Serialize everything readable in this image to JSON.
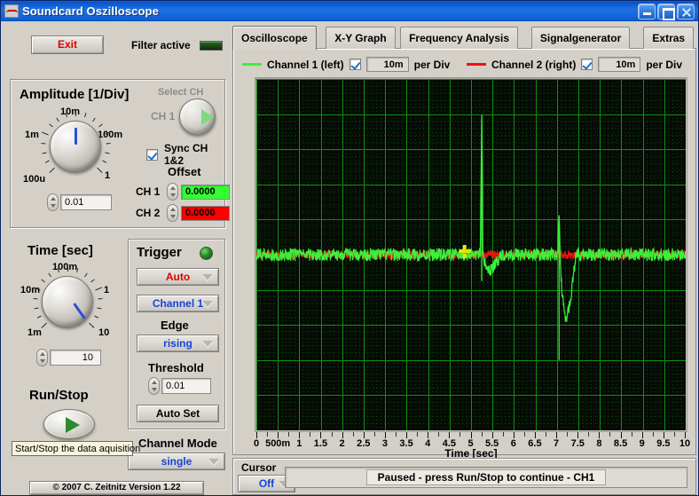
{
  "window": {
    "title": "Soundcard Oszilloscope",
    "icon": "app-waveform-icon",
    "minimize": "minimize-icon",
    "maximize": "maximize-icon",
    "close": "close-icon"
  },
  "left": {
    "exit_label": "Exit",
    "filter_label": "Filter active",
    "amplitude": {
      "title": "Amplitude [1/Div]",
      "scale_labels": [
        "100u",
        "1m",
        "10m",
        "100m",
        "1"
      ],
      "value": "0.01",
      "select_ch_label": "Select CH",
      "ch_label": "CH 1",
      "sync_label": "Sync CH 1&2",
      "sync_checked": true,
      "offset_title": "Offset",
      "offset_ch1_label": "CH 1",
      "offset_ch1_value": "0.0000",
      "offset_ch2_label": "CH 2",
      "offset_ch2_value": "0.0000",
      "ch1_color": "#33ff33",
      "ch2_color": "#ff0000"
    },
    "time": {
      "title": "Time [sec]",
      "scale_labels": [
        "1m",
        "10m",
        "100m",
        "1",
        "10"
      ],
      "value": "10"
    },
    "trigger": {
      "title": "Trigger",
      "mode": "Auto",
      "source": "Channel 1",
      "edge_label": "Edge",
      "edge": "rising",
      "threshold_label": "Threshold",
      "threshold": "0.01",
      "autoset_label": "Auto Set"
    },
    "runstop": {
      "title": "Run/Stop",
      "tooltip": "Start/Stop the data aquisition"
    },
    "channel_mode": {
      "label": "Channel Mode",
      "value": "single"
    },
    "copyright": "© 2007   C. Zeitnitz Version 1.22"
  },
  "tabs": [
    {
      "label": "Oscilloscope",
      "active": true
    },
    {
      "label": "X-Y Graph",
      "active": false
    },
    {
      "label": "Frequency Analysis",
      "active": false
    },
    {
      "label": "Signalgenerator",
      "active": false
    },
    {
      "label": "Extras",
      "active": false
    }
  ],
  "channels": [
    {
      "name": "Channel 1 (left)",
      "color": "#3cf03c",
      "enabled": true,
      "per_div": "10m",
      "per_div_label": "per Div"
    },
    {
      "name": "Channel 2 (right)",
      "color": "#ee1111",
      "enabled": true,
      "per_div": "10m",
      "per_div_label": "per Div"
    }
  ],
  "cursor": {
    "label": "Cursor",
    "value": "Off"
  },
  "status": "Paused - press Run/Stop to continue - CH1",
  "chart_data": {
    "type": "line",
    "title": "",
    "xlabel": "Time [sec]",
    "ylabel": "",
    "xlim": [
      0,
      10
    ],
    "ylim": [
      -0.05,
      0.05
    ],
    "xticks": [
      0,
      0.5,
      1,
      1.5,
      2,
      2.5,
      3,
      3.5,
      4,
      4.5,
      5,
      5.5,
      6,
      6.5,
      7,
      7.5,
      8,
      8.5,
      9,
      9.5,
      10
    ],
    "xticklabels": [
      "0",
      "500m",
      "1",
      "1.5",
      "2",
      "2.5",
      "3",
      "3.5",
      "4",
      "4.5",
      "5",
      "5.5",
      "6",
      "6.5",
      "7",
      "7.5",
      "8",
      "8.5",
      "9",
      "9.5",
      "10"
    ],
    "grid": true,
    "grid_color": "#0f8f0f",
    "minor_grid_color": "#0a4a0a",
    "background": "#050b05",
    "legend": [
      "Channel 1 (left)",
      "Channel 2 (right)"
    ],
    "legend_position": "top",
    "cursor_marker": {
      "x": 4.85,
      "y": 0.001,
      "color": "#e8e800",
      "shape": "cross"
    },
    "series": [
      {
        "name": "Channel 1 (left)",
        "color": "#3cf03c",
        "noise_amplitude": 0.0018,
        "baseline": 0.0,
        "events": [
          {
            "x": 5.25,
            "type": "spike",
            "peak": 0.0385,
            "undershoot": -0.0075,
            "width": 0.45
          },
          {
            "x": 7.05,
            "type": "spike",
            "peak": 0.0105,
            "undershoot": -0.03,
            "width": 0.4
          }
        ]
      },
      {
        "name": "Channel 2 (right)",
        "color": "#ee1111",
        "noise_amplitude": 0.0012,
        "baseline": 0.0,
        "events": []
      }
    ]
  }
}
